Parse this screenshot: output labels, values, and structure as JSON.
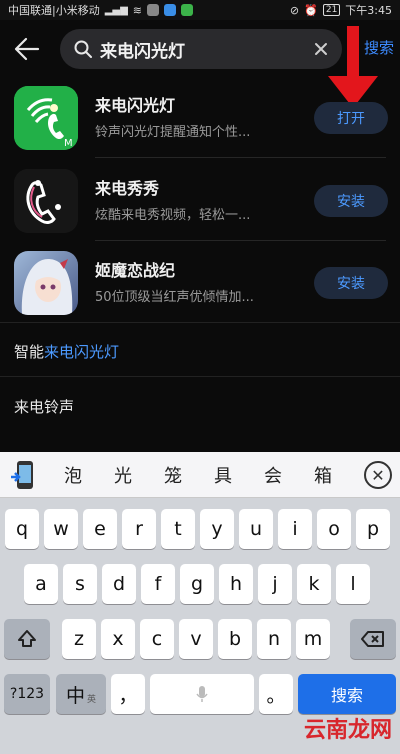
{
  "status_bar": {
    "carrier": "中国联通|小米移动",
    "battery": "21",
    "time": "下午3:45"
  },
  "header": {
    "search_value": "来电闪光灯",
    "search_action": "搜索"
  },
  "apps": [
    {
      "name": "来电闪光灯",
      "desc": "铃声闪光灯提醒通知个性...",
      "button": "打开",
      "icon": "flash-phone-icon"
    },
    {
      "name": "来电秀秀",
      "desc": "炫酷来电秀视频，轻松一...",
      "button": "安装",
      "icon": "phone-face-icon"
    },
    {
      "name": "姬魔恋战纪",
      "desc": "50位顶级当红声优倾情加...",
      "button": "安装",
      "icon": "anime-girl-icon"
    }
  ],
  "suggestions": {
    "first_prefix": "智能",
    "first_highlight": "来电闪光灯",
    "second": "来电铃声"
  },
  "keyboard": {
    "candidates": [
      "泡",
      "光",
      "笼",
      "具",
      "会",
      "箱"
    ],
    "row1": [
      "q",
      "w",
      "e",
      "r",
      "t",
      "y",
      "u",
      "i",
      "o",
      "p"
    ],
    "row2": [
      "a",
      "s",
      "d",
      "f",
      "g",
      "h",
      "j",
      "k",
      "l"
    ],
    "row3": [
      "z",
      "x",
      "c",
      "v",
      "b",
      "n",
      "m"
    ],
    "num_key": "?123",
    "lang_key": "中",
    "lang_sub": "英",
    "comma_key": "，",
    "period_key": "。",
    "search_key": "搜索"
  },
  "watermark": "云南龙网",
  "colors": {
    "accent": "#4c9aff",
    "arrow": "#e3161c"
  }
}
